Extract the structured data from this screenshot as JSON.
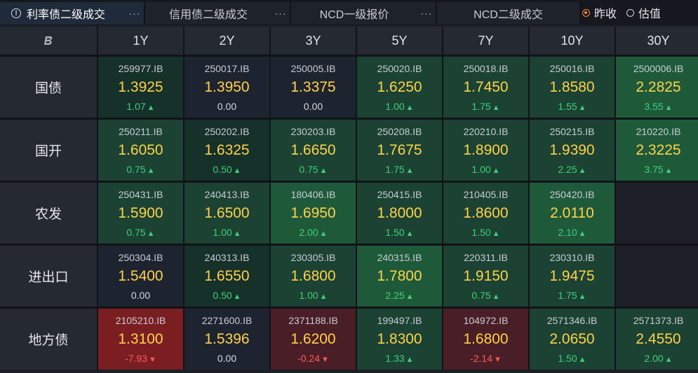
{
  "tabs": [
    {
      "label": "利率债二级成交",
      "more": "···"
    },
    {
      "label": "信用债二级成交",
      "more": "···"
    },
    {
      "label": "NCD一级报价",
      "more": "···"
    },
    {
      "label": "NCD二级成交",
      "more": ""
    }
  ],
  "radios": [
    {
      "label": "昨收",
      "selected": true
    },
    {
      "label": "估值",
      "selected": false
    }
  ],
  "tenors": [
    "1Y",
    "2Y",
    "3Y",
    "5Y",
    "7Y",
    "10Y",
    "30Y"
  ],
  "rows": [
    {
      "name": "国债",
      "cells": [
        {
          "code": "259977.IB",
          "yield": "1.3925",
          "chg": "1.07",
          "dir": "up",
          "shade": "g1"
        },
        {
          "code": "250017.IB",
          "yield": "1.3950",
          "chg": "0.00",
          "dir": "flat",
          "shade": "n0"
        },
        {
          "code": "250005.IB",
          "yield": "1.3375",
          "chg": "0.00",
          "dir": "flat",
          "shade": "n0"
        },
        {
          "code": "250020.IB",
          "yield": "1.6250",
          "chg": "1.00",
          "dir": "up",
          "shade": "g2"
        },
        {
          "code": "250018.IB",
          "yield": "1.7450",
          "chg": "1.75",
          "dir": "up",
          "shade": "g2"
        },
        {
          "code": "250016.IB",
          "yield": "1.8580",
          "chg": "1.55",
          "dir": "up",
          "shade": "g2"
        },
        {
          "code": "2500006.IB",
          "yield": "2.2825",
          "chg": "3.55",
          "dir": "up",
          "shade": "g3"
        }
      ]
    },
    {
      "name": "国开",
      "cells": [
        {
          "code": "250211.IB",
          "yield": "1.6050",
          "chg": "0.75",
          "dir": "up",
          "shade": "g2"
        },
        {
          "code": "250202.IB",
          "yield": "1.6325",
          "chg": "0.50",
          "dir": "up",
          "shade": "g1"
        },
        {
          "code": "230203.IB",
          "yield": "1.6650",
          "chg": "0.75",
          "dir": "up",
          "shade": "g2"
        },
        {
          "code": "250208.IB",
          "yield": "1.7675",
          "chg": "1.75",
          "dir": "up",
          "shade": "g2"
        },
        {
          "code": "220210.IB",
          "yield": "1.8900",
          "chg": "1.00",
          "dir": "up",
          "shade": "g2"
        },
        {
          "code": "250215.IB",
          "yield": "1.9390",
          "chg": "2.25",
          "dir": "up",
          "shade": "g2"
        },
        {
          "code": "210220.IB",
          "yield": "2.3225",
          "chg": "3.75",
          "dir": "up",
          "shade": "g3"
        }
      ]
    },
    {
      "name": "农发",
      "cells": [
        {
          "code": "250431.IB",
          "yield": "1.5900",
          "chg": "0.75",
          "dir": "up",
          "shade": "g2"
        },
        {
          "code": "240413.IB",
          "yield": "1.6500",
          "chg": "1.00",
          "dir": "up",
          "shade": "g2"
        },
        {
          "code": "180406.IB",
          "yield": "1.6950",
          "chg": "2.00",
          "dir": "up",
          "shade": "g3"
        },
        {
          "code": "250415.IB",
          "yield": "1.8000",
          "chg": "1.50",
          "dir": "up",
          "shade": "g2"
        },
        {
          "code": "210405.IB",
          "yield": "1.8600",
          "chg": "1.50",
          "dir": "up",
          "shade": "g2"
        },
        {
          "code": "250420.IB",
          "yield": "2.0110",
          "chg": "2.10",
          "dir": "up",
          "shade": "g3"
        },
        null
      ]
    },
    {
      "name": "进出口",
      "cells": [
        {
          "code": "250304.IB",
          "yield": "1.5400",
          "chg": "0.00",
          "dir": "flat",
          "shade": "n0"
        },
        {
          "code": "240313.IB",
          "yield": "1.6550",
          "chg": "0.50",
          "dir": "up",
          "shade": "g1"
        },
        {
          "code": "230305.IB",
          "yield": "1.6800",
          "chg": "1.00",
          "dir": "up",
          "shade": "g2"
        },
        {
          "code": "240315.IB",
          "yield": "1.7800",
          "chg": "2.25",
          "dir": "up",
          "shade": "g3"
        },
        {
          "code": "220311.IB",
          "yield": "1.9150",
          "chg": "0.75",
          "dir": "up",
          "shade": "g2"
        },
        {
          "code": "230310.IB",
          "yield": "1.9475",
          "chg": "1.75",
          "dir": "up",
          "shade": "g2"
        },
        null
      ]
    },
    {
      "name": "地方债",
      "cells": [
        {
          "code": "2105210.IB",
          "yield": "1.3100",
          "chg": "-7.93",
          "dir": "down",
          "shade": "r1"
        },
        {
          "code": "2271600.IB",
          "yield": "1.5396",
          "chg": "0.00",
          "dir": "flat",
          "shade": "n0"
        },
        {
          "code": "2371188.IB",
          "yield": "1.6200",
          "chg": "-0.24",
          "dir": "down",
          "shade": "r2"
        },
        {
          "code": "199497.IB",
          "yield": "1.8300",
          "chg": "1.33",
          "dir": "up",
          "shade": "g2"
        },
        {
          "code": "104972.IB",
          "yield": "1.6800",
          "chg": "-2.14",
          "dir": "down",
          "shade": "r2"
        },
        {
          "code": "2571346.IB",
          "yield": "2.0650",
          "chg": "1.50",
          "dir": "up",
          "shade": "g2"
        },
        {
          "code": "2571373.IB",
          "yield": "2.4550",
          "chg": "2.00",
          "dir": "up",
          "shade": "g2"
        }
      ]
    }
  ],
  "colors": {
    "accent": "#ff8a2a",
    "yield": "#ffd24a",
    "up": "#3fd17a",
    "down": "#ff5a5a"
  }
}
